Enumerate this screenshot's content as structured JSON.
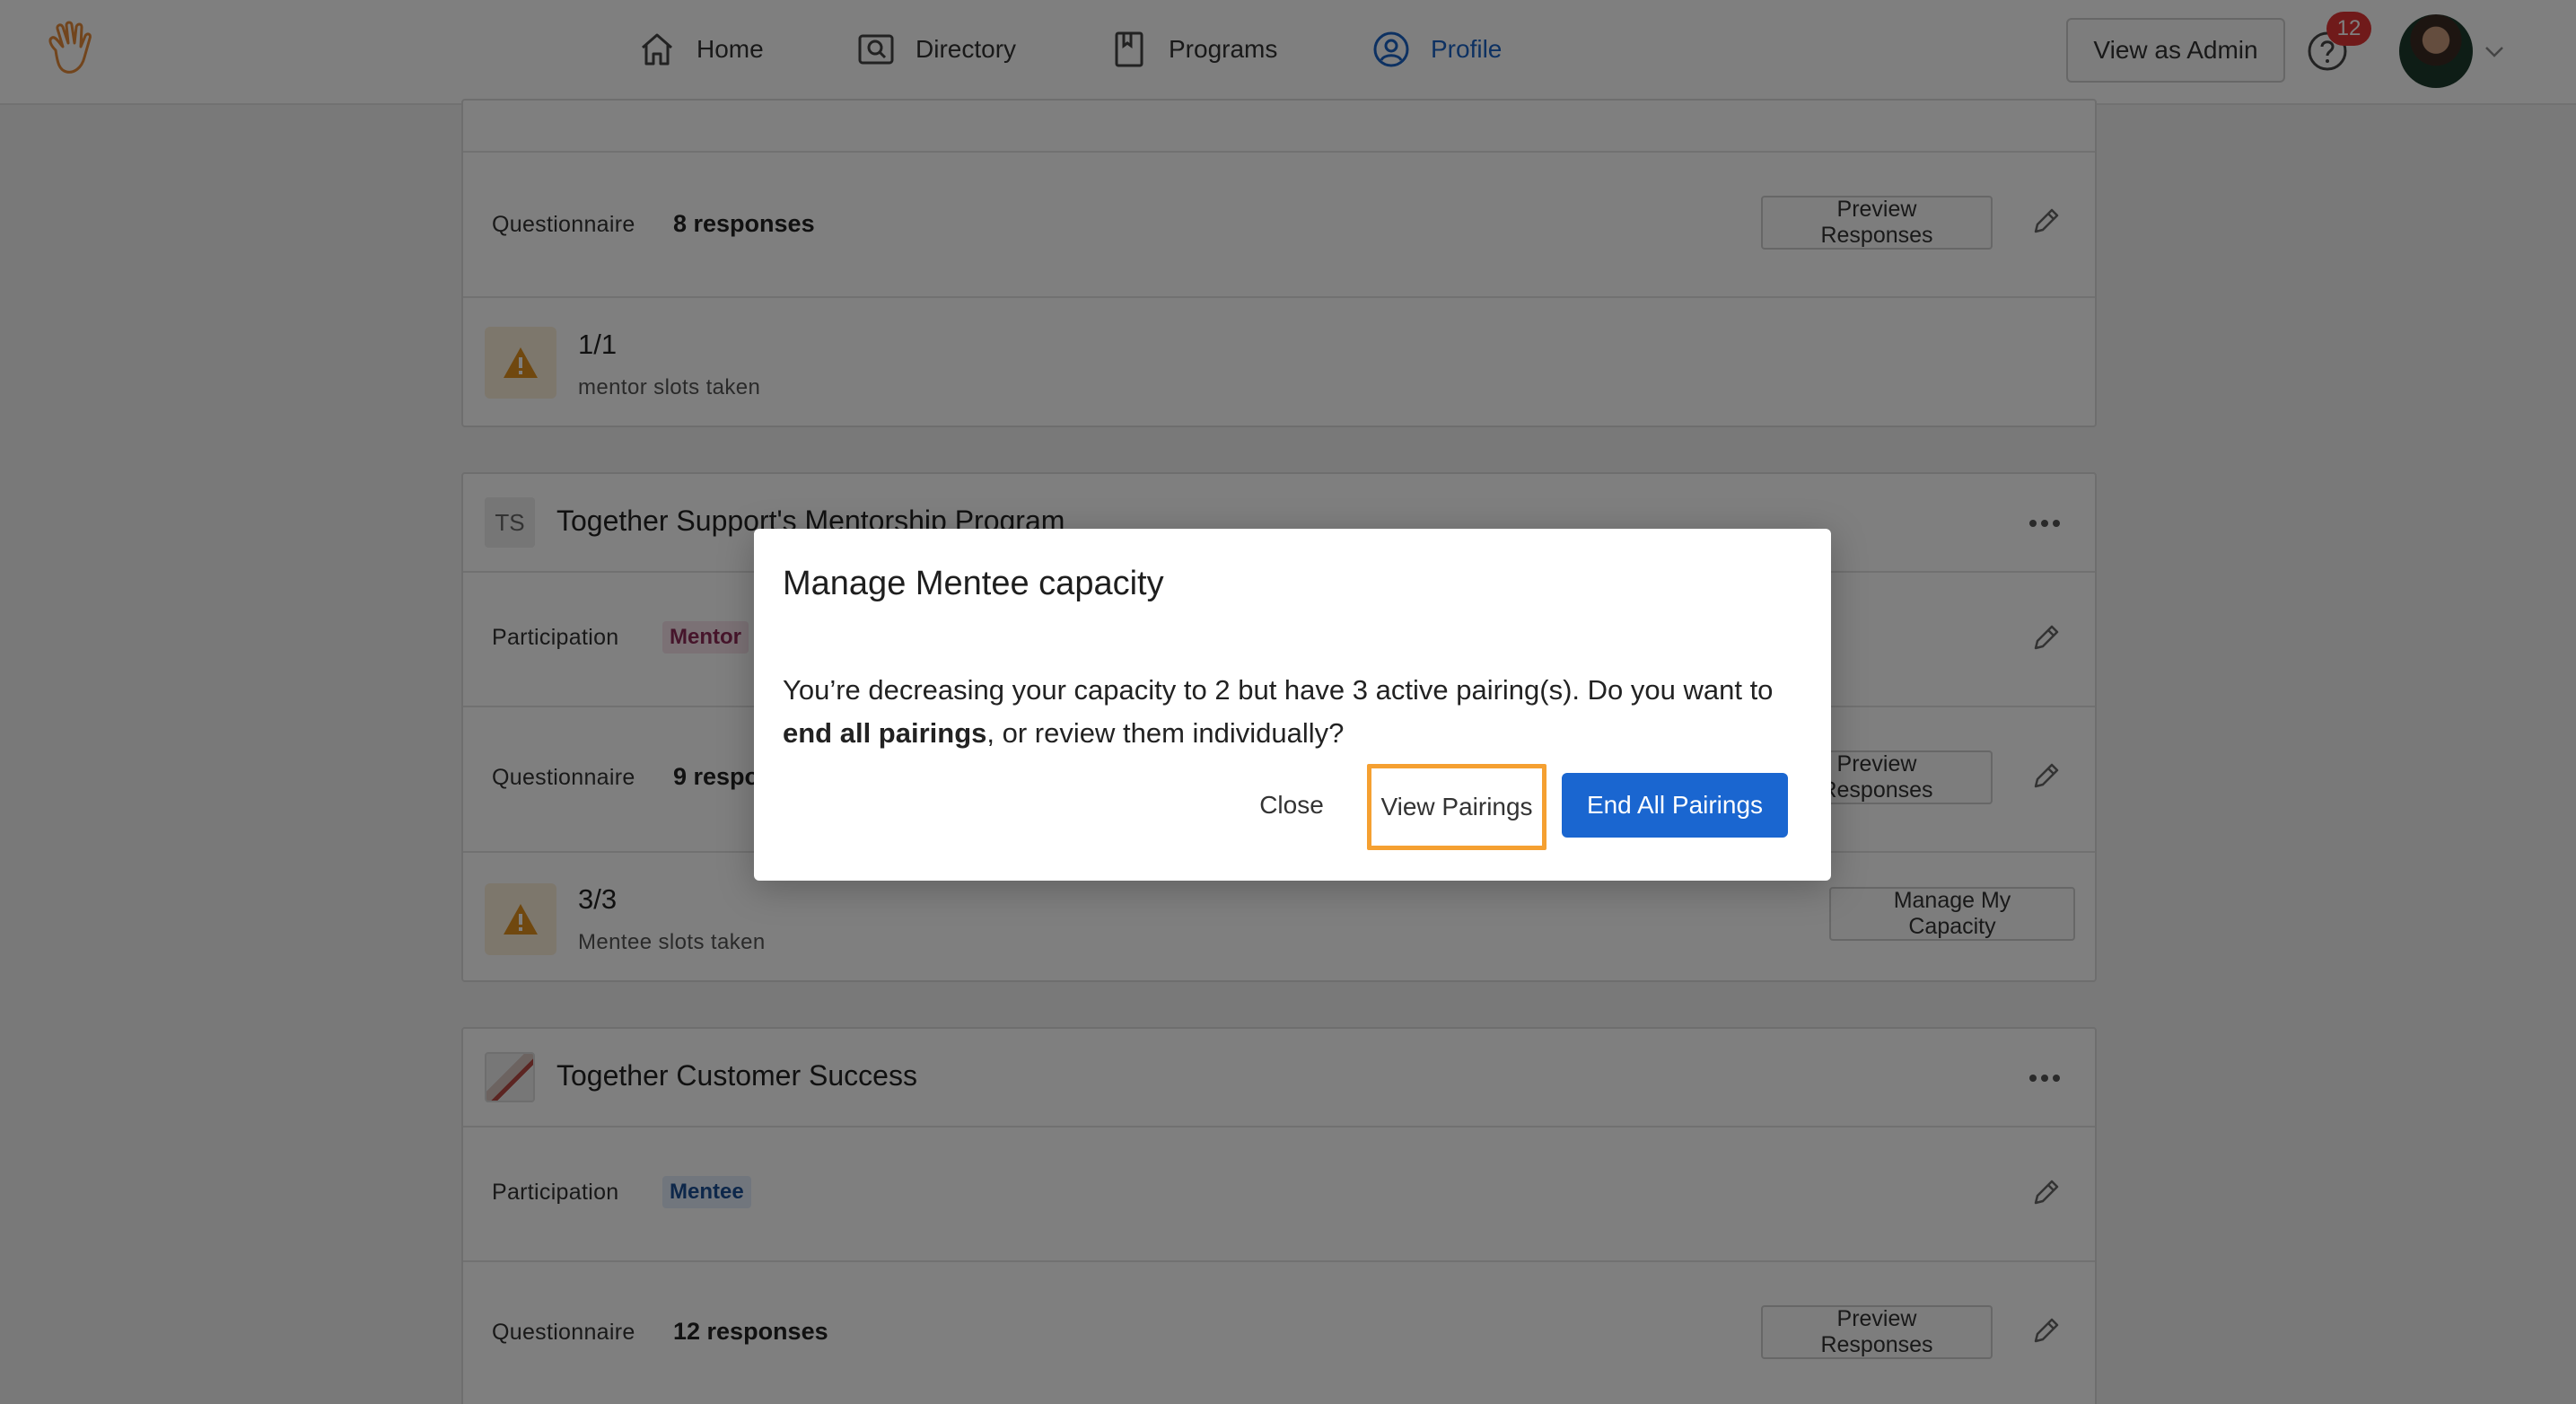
{
  "nav": {
    "items": [
      {
        "label": "Home",
        "icon": "home-icon"
      },
      {
        "label": "Directory",
        "icon": "directory-icon"
      },
      {
        "label": "Programs",
        "icon": "programs-icon"
      },
      {
        "label": "Profile",
        "icon": "profile-icon",
        "active": true
      }
    ],
    "admin_label": "View as Admin",
    "notification_count": "12",
    "accent_color": "#1a63c4"
  },
  "card1": {
    "questionnaire_label": "Questionnaire",
    "questionnaire_value": "8 responses",
    "preview_label": "Preview Responses",
    "slots_value": "1/1",
    "slots_text": "mentor slots taken"
  },
  "card2": {
    "initials": "TS",
    "title": "Together Support's Mentorship Program",
    "participation_label": "Participation",
    "participation_tag": "Mentor",
    "questionnaire_label": "Questionnaire",
    "questionnaire_value": "9 responses",
    "preview_label": "Preview Responses",
    "slots_value": "3/3",
    "slots_text": "Mentee slots taken",
    "capacity_label": "Manage My Capacity"
  },
  "card3": {
    "title": "Together Customer Success",
    "participation_label": "Participation",
    "participation_tag": "Mentee",
    "questionnaire_label": "Questionnaire",
    "questionnaire_value": "12 responses",
    "preview_label": "Preview Responses"
  },
  "modal": {
    "title": "Manage Mentee capacity",
    "body_pre": "You’re decreasing your capacity to 2 but have 3 active pairing(s). Do you want to ",
    "body_bold": "end all pairings",
    "body_post": ", or review them individually?",
    "close_label": "Close",
    "view_label": "View Pairings",
    "end_label": "End All Pairings",
    "primary_color": "#1a66d0",
    "highlight_color": "#f5a031"
  }
}
